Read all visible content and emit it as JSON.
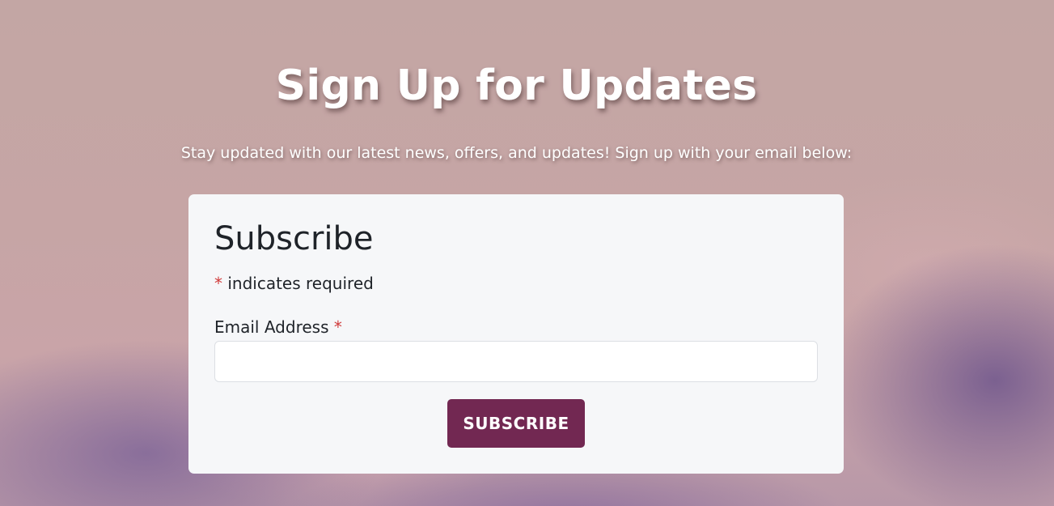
{
  "hero": {
    "title": "Sign Up for Updates",
    "subtitle": "Stay updated with our latest news, offers, and updates! Sign up with your email below:"
  },
  "form": {
    "title": "Subscribe",
    "required_asterisk": "*",
    "required_note": " indicates required",
    "email_label": "Email Address",
    "email_required_asterisk": "*",
    "email_value": "",
    "email_placeholder": "",
    "submit_label": "SUBSCRIBE"
  },
  "colors": {
    "button": "#722852",
    "required_asterisk": "#d03a3a",
    "card_background": "#f6f7f9"
  }
}
